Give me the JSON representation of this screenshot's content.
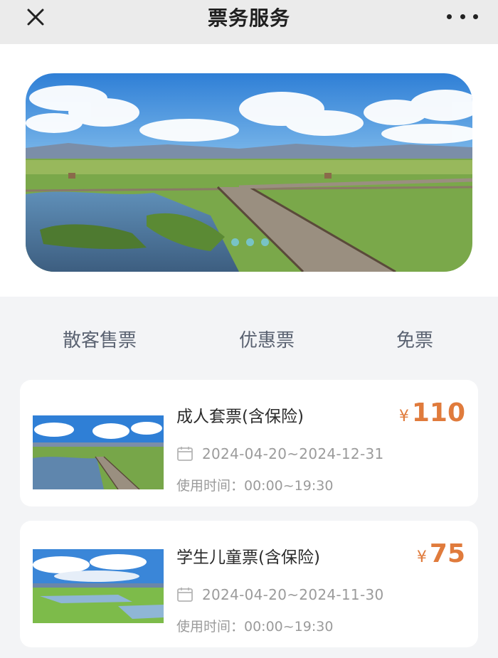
{
  "header": {
    "title": "票务服务",
    "close_icon": "close-icon",
    "more_icon": "more-dots-icon"
  },
  "banner": {
    "image": "wetland boardwalk landscape",
    "slide_count": 3
  },
  "tabs": [
    {
      "label": "散客售票"
    },
    {
      "label": "优惠票"
    },
    {
      "label": "免票"
    }
  ],
  "tickets": [
    {
      "name": "成人套票(含保险)",
      "currency": "¥",
      "price": "110",
      "date_range": "2024-04-20~2024-12-31",
      "time": "使用时间：00:00~19:30",
      "icon": "calendar-icon"
    },
    {
      "name": "学生儿童票(含保险)",
      "currency": "¥",
      "price": "75",
      "date_range": "2024-04-20~2024-11-30",
      "time": "使用时间：00:00~19:30",
      "icon": "calendar-icon"
    }
  ],
  "colors": {
    "price": "#e07b3c",
    "tab_text": "#5a6271",
    "header_bg": "#ebebeb",
    "page_bg": "#f3f4f6"
  }
}
